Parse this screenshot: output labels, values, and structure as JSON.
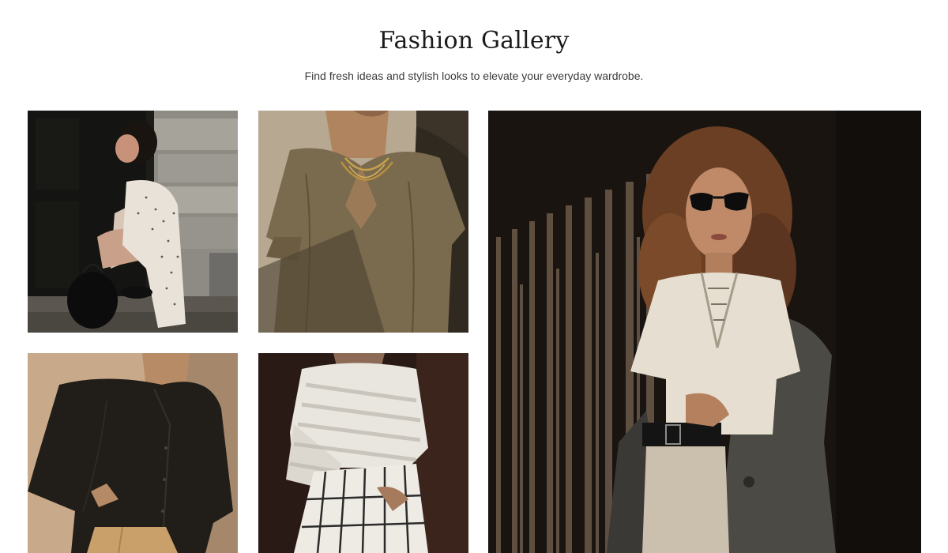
{
  "gallery": {
    "title": "Fashion Gallery",
    "subtitle": "Find fresh ideas and stylish looks to elevate your everyday wardrobe."
  },
  "photos": [
    {
      "subject": "woman in white polka dot dress crouching by stone wall with black bag"
    },
    {
      "subject": "woman in olive linen smock top with layered gold necklaces"
    },
    {
      "subject": "woman in black button-up blouse with tan skirt"
    },
    {
      "subject": "woman in white knit sweater and checked trousers in striped light"
    },
    {
      "subject": "curly-haired woman in sunglasses, cream lace-up sweater and grey coat by striped wall"
    }
  ],
  "colors": {
    "background": "#ffffff",
    "title": "#1b1b1b",
    "subtitle": "#3a3a3a"
  }
}
